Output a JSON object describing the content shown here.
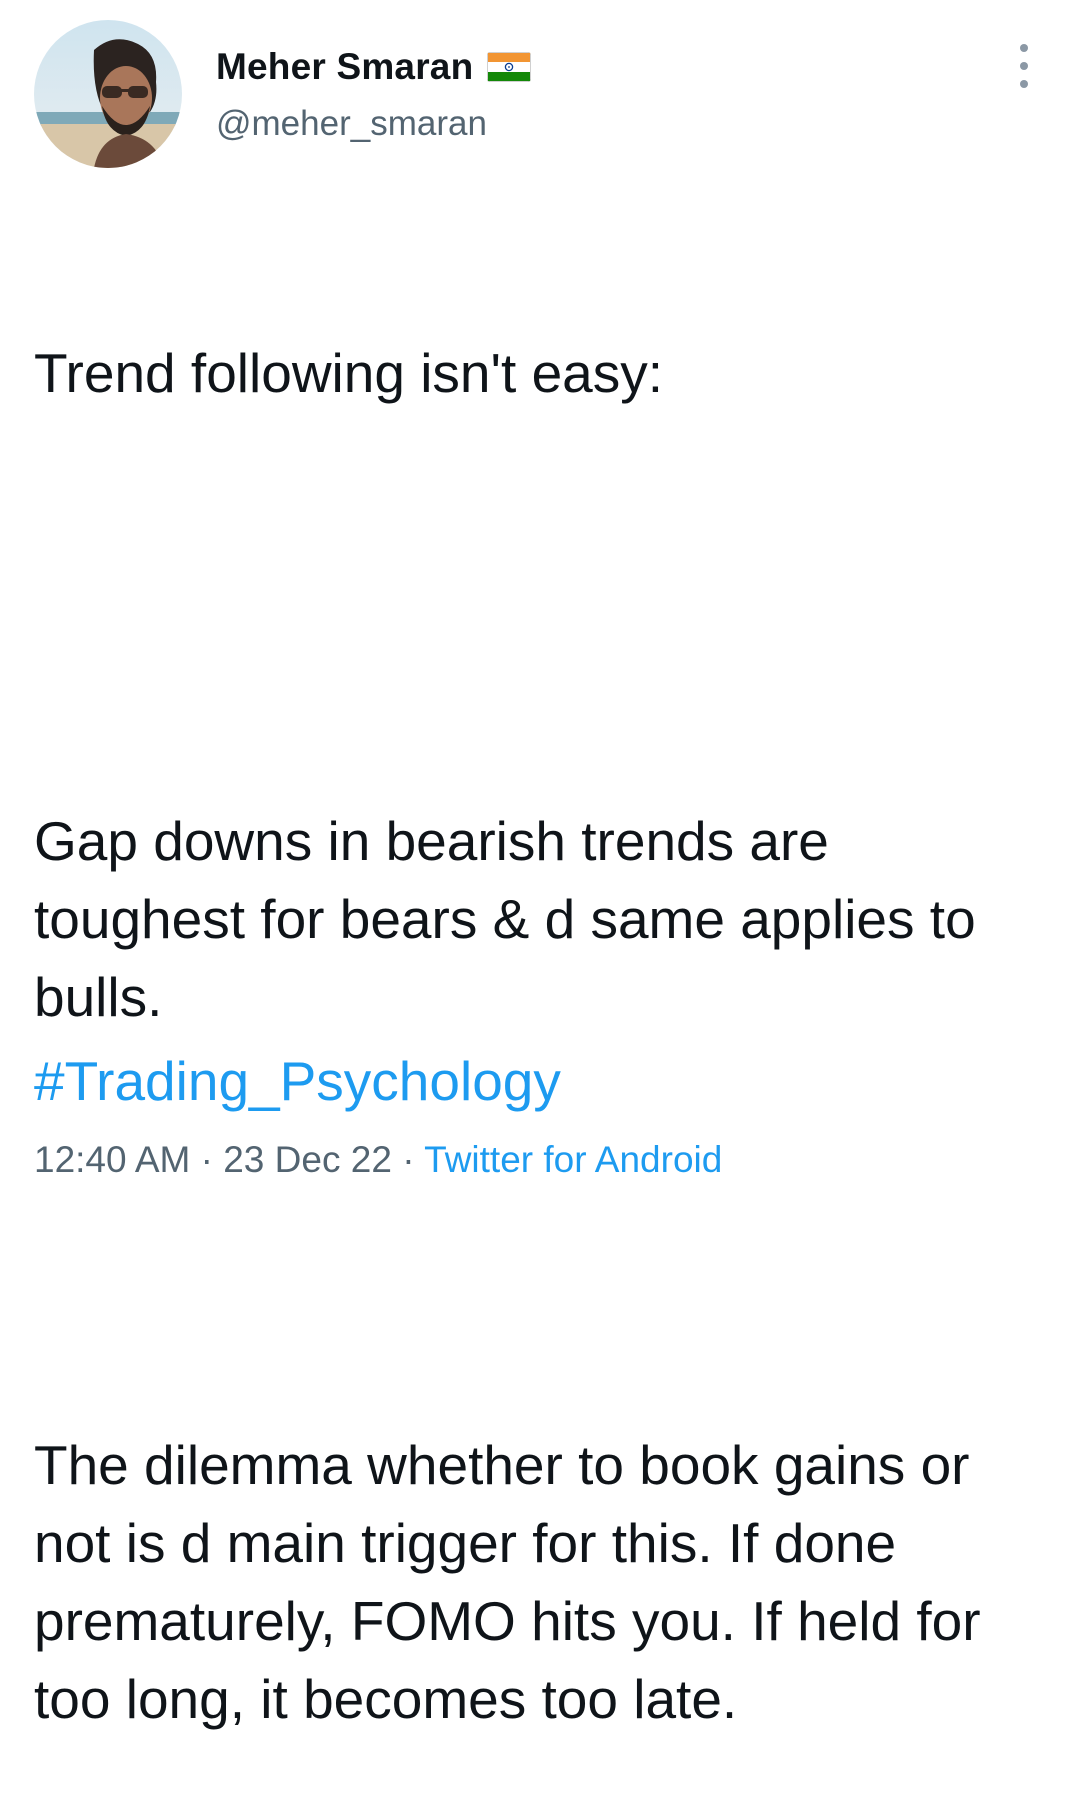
{
  "author": {
    "display_name": "Meher Smaran",
    "handle": "@meher_smaran",
    "flag_icon": "india-flag-icon",
    "avatar_icon": "avatar-photo"
  },
  "tweet": {
    "paragraphs": [
      "Trend following isn't easy:",
      "Gap downs in bearish trends are toughest for bears & d same applies to bulls.",
      "The dilemma whether to book gains or not is d main trigger for this. If done prematurely, FOMO hits you. If held for too long, it becomes too late."
    ],
    "hashtag": "#Trading_Psychology"
  },
  "meta": {
    "time": "12:40 AM",
    "separator": "·",
    "date": "23 Dec 22",
    "source": "Twitter for Android"
  },
  "colors": {
    "text": "#0f1419",
    "secondary": "#536471",
    "link": "#1d9bf0"
  },
  "icons": {
    "more": "more-vertical-icon"
  }
}
